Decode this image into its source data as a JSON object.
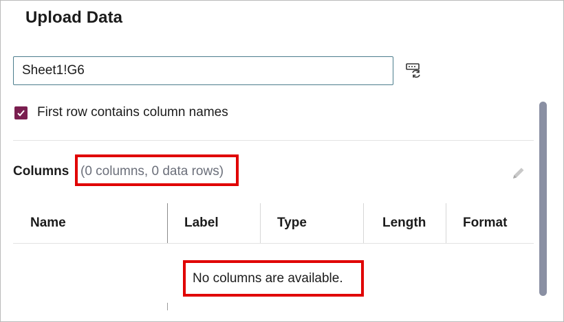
{
  "dialog": {
    "title": "Upload Data"
  },
  "range": {
    "value": "Sheet1!G6",
    "refresh_icon": "refresh-sheet-icon"
  },
  "options": {
    "first_row_label": "First row contains column names",
    "first_row_checked": true
  },
  "columns": {
    "title": "Columns",
    "summary": "(0 columns, 0 data rows)",
    "edit_icon": "pencil-icon",
    "headers": [
      "Name",
      "Label",
      "Type",
      "Length",
      "Format"
    ],
    "empty_message": "No columns are available."
  },
  "colors": {
    "accent": "#7a1e4f",
    "highlight": "#e00000",
    "meta_text": "#6b6f7a"
  }
}
